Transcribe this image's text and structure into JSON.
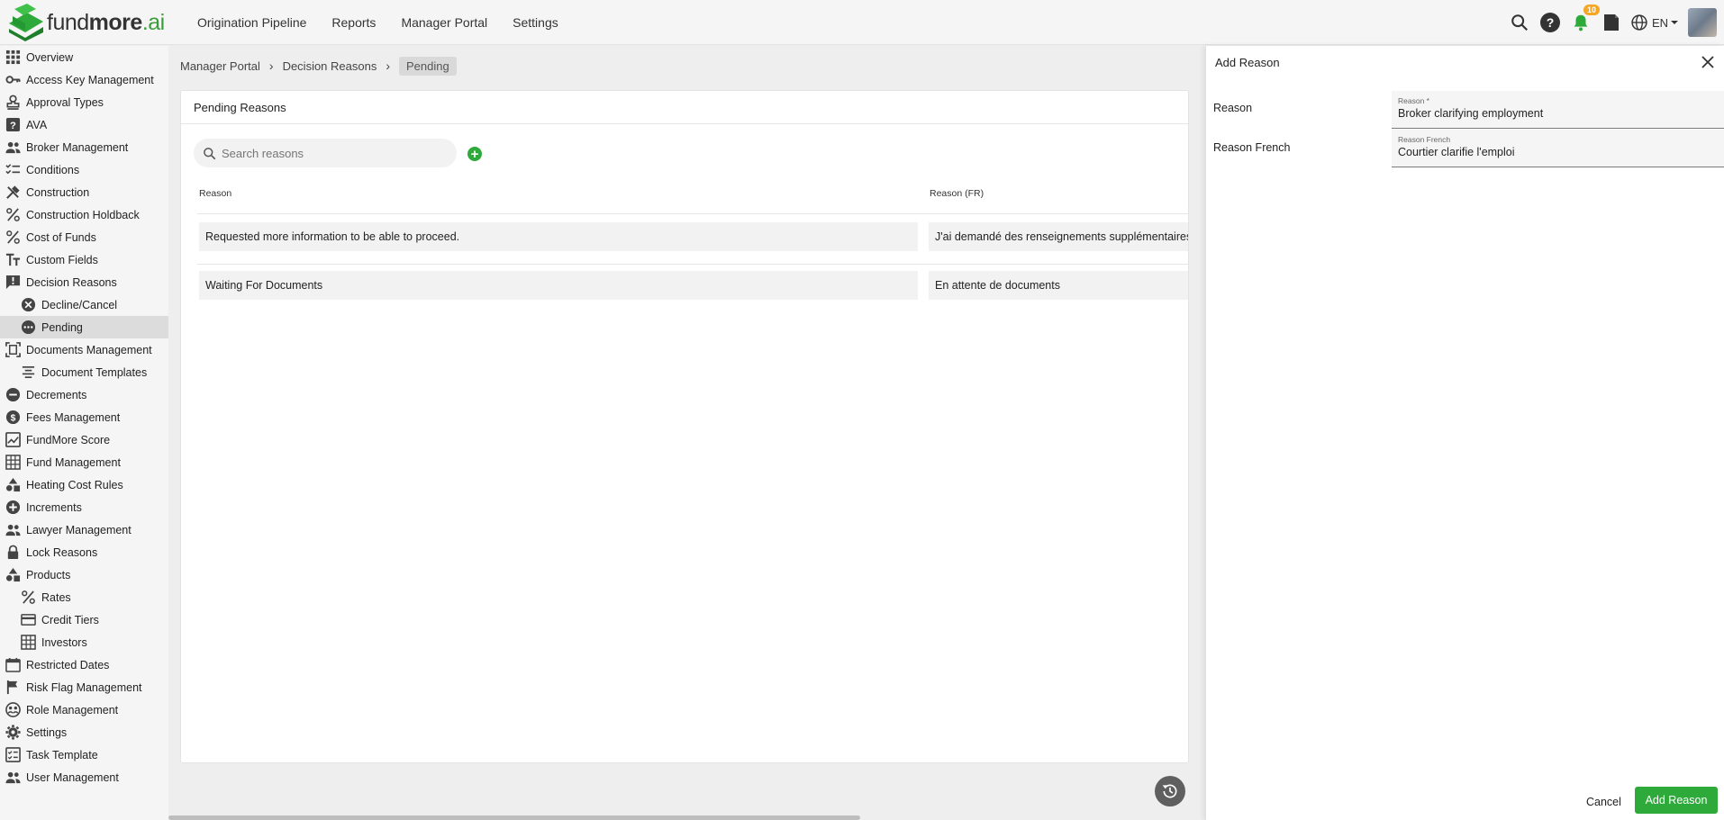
{
  "brand": {
    "part1": "fund",
    "part2": "more",
    "part3": ".ai",
    "accent": "#2eaa3a"
  },
  "topnav": [
    {
      "label": "Origination Pipeline"
    },
    {
      "label": "Reports"
    },
    {
      "label": "Manager Portal"
    },
    {
      "label": "Settings"
    }
  ],
  "topbar": {
    "notifications_count": "10",
    "language": "EN"
  },
  "sidebar": {
    "items": [
      {
        "label": "Overview",
        "icon": "grid-icon"
      },
      {
        "label": "Access Key Management",
        "icon": "key-icon"
      },
      {
        "label": "Approval Types",
        "icon": "stamp-icon"
      },
      {
        "label": "AVA",
        "icon": "help-icon"
      },
      {
        "label": "Broker Management",
        "icon": "people-icon"
      },
      {
        "label": "Conditions",
        "icon": "checklist-icon"
      },
      {
        "label": "Construction",
        "icon": "tools-icon"
      },
      {
        "label": "Construction Holdback",
        "icon": "percent-icon"
      },
      {
        "label": "Cost of Funds",
        "icon": "percent-icon"
      },
      {
        "label": "Custom Fields",
        "icon": "text-fields-icon"
      },
      {
        "label": "Decision Reasons",
        "icon": "feedback-icon"
      },
      {
        "label": "Decline/Cancel",
        "icon": "cancel-circle-icon"
      },
      {
        "label": "Pending",
        "icon": "pending-icon"
      },
      {
        "label": "Documents Management",
        "icon": "document-scan-icon"
      },
      {
        "label": "Document Templates",
        "icon": "align-center-icon"
      },
      {
        "label": "Decrements",
        "icon": "minus-circle-icon"
      },
      {
        "label": "Fees Management",
        "icon": "dollar-circle-icon"
      },
      {
        "label": "FundMore Score",
        "icon": "score-icon"
      },
      {
        "label": "Fund Management",
        "icon": "table-icon"
      },
      {
        "label": "Heating Cost Rules",
        "icon": "shapes-icon"
      },
      {
        "label": "Increments",
        "icon": "plus-circle-icon"
      },
      {
        "label": "Lawyer Management",
        "icon": "people-icon"
      },
      {
        "label": "Lock Reasons",
        "icon": "lock-icon"
      },
      {
        "label": "Products",
        "icon": "shapes-icon"
      },
      {
        "label": "Rates",
        "icon": "percent-icon"
      },
      {
        "label": "Credit Tiers",
        "icon": "card-icon"
      },
      {
        "label": "Investors",
        "icon": "table-icon"
      },
      {
        "label": "Restricted Dates",
        "icon": "calendar-icon"
      },
      {
        "label": "Risk Flag Management",
        "icon": "flag-icon"
      },
      {
        "label": "Role Management",
        "icon": "role-icon"
      },
      {
        "label": "Settings",
        "icon": "gear-icon"
      },
      {
        "label": "Task Template",
        "icon": "task-icon"
      },
      {
        "label": "User Management",
        "icon": "people-icon"
      }
    ]
  },
  "breadcrumb": {
    "items": [
      "Manager Portal",
      "Decision Reasons",
      "Pending"
    ]
  },
  "main": {
    "card_title": "Pending Reasons",
    "search_placeholder": "Search reasons",
    "columns": [
      "Reason",
      "Reason (FR)"
    ],
    "rows": [
      {
        "reason": "Requested more information to be able to proceed.",
        "reason_fr": "J'ai demandé des renseignements supplémentaires pou"
      },
      {
        "reason": "Waiting For Documents",
        "reason_fr": "En attente de documents"
      }
    ]
  },
  "drawer": {
    "title": "Add Reason",
    "fields": [
      {
        "label": "Reason",
        "float_label": "Reason *",
        "value": "Broker clarifying employment"
      },
      {
        "label": "Reason French",
        "float_label": "Reason French",
        "value": "Courtier clarifie l'emploi"
      }
    ],
    "cancel_label": "Cancel",
    "submit_label": "Add Reason"
  }
}
